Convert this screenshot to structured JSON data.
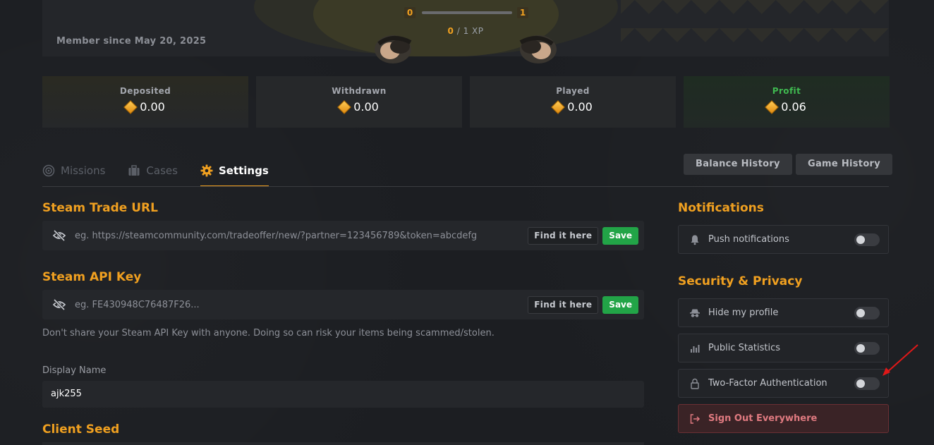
{
  "header": {
    "member_since": "Member since May 20, 2025",
    "level_current": "0",
    "level_next": "1",
    "xp_current": "0",
    "xp_rest": " / 1 XP"
  },
  "stats": [
    {
      "label": "Deposited",
      "value": "0.00"
    },
    {
      "label": "Withdrawn",
      "value": "0.00"
    },
    {
      "label": "Played",
      "value": "0.00"
    },
    {
      "label": "Profit",
      "value": "0.06"
    }
  ],
  "tabs": [
    {
      "label": "Missions",
      "icon": "target-icon",
      "active": false
    },
    {
      "label": "Cases",
      "icon": "briefcase-icon",
      "active": false
    },
    {
      "label": "Settings",
      "icon": "gear-icon",
      "active": true
    }
  ],
  "history_buttons": {
    "balance": "Balance History",
    "game": "Game History"
  },
  "trade_url": {
    "title": "Steam Trade URL",
    "placeholder": "eg. https://steamcommunity.com/tradeoffer/new/?partner=123456789&token=abcdefg",
    "find_label": "Find it here",
    "save_label": "Save"
  },
  "api_key": {
    "title": "Steam API Key",
    "placeholder": "eg. FE430948C76487F26...",
    "find_label": "Find it here",
    "save_label": "Save",
    "warning": "Don't share your Steam API Key with anyone. Doing so can risk your items being scammed/stolen."
  },
  "display_name": {
    "label": "Display Name",
    "value": "ajk255"
  },
  "client_seed": {
    "title": "Client Seed"
  },
  "notifications": {
    "title": "Notifications",
    "push_label": "Push notifications",
    "push_enabled": false
  },
  "security": {
    "title": "Security & Privacy",
    "items": [
      {
        "label": "Hide my profile",
        "icon": "spy-icon",
        "enabled": false
      },
      {
        "label": "Public Statistics",
        "icon": "bar-chart-icon",
        "enabled": false
      },
      {
        "label": "Two-Factor Authentication",
        "icon": "lock-icon",
        "enabled": false
      }
    ],
    "sign_out_label": "Sign Out Everywhere"
  },
  "colors": {
    "accent": "#f0a020",
    "save_green": "#22a447",
    "profit_green": "#3fb950",
    "danger": "#e07a80"
  }
}
